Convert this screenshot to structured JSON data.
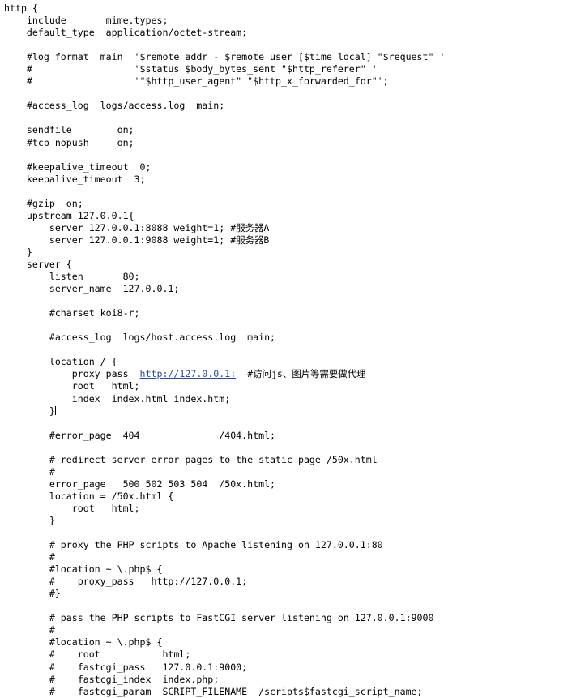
{
  "document": {
    "type": "nginx-configuration-file",
    "language": "nginx-conf",
    "background_color": "#ffffff",
    "text_color": "#000000",
    "link_color": "#2b4ba8",
    "caret_after_line_index": 33
  },
  "lines": [
    "http {",
    "    include       mime.types;",
    "    default_type  application/octet-stream;",
    "",
    "    #log_format  main  '$remote_addr - $remote_user [$time_local] \"$request\" '",
    "    #                  '$status $body_bytes_sent \"$http_referer\" '",
    "    #                  '\"$http_user_agent\" \"$http_x_forwarded_for\"';",
    "",
    "    #access_log  logs/access.log  main;",
    "",
    "    sendfile        on;",
    "    #tcp_nopush     on;",
    "",
    "    #keepalive_timeout  0;",
    "    keepalive_timeout  3;",
    "",
    "    #gzip  on;",
    "    upstream 127.0.0.1{",
    "        server 127.0.0.1:8088 weight=1; #服务器A",
    "        server 127.0.0.1:9088 weight=1; #服务器B",
    "    }",
    "    server {",
    "        listen       80;",
    "        server_name  127.0.0.1;",
    "",
    "        #charset koi8-r;",
    "",
    "        #access_log  logs/host.access.log  main;",
    "",
    "        location / {",
    "            proxy_pass  http://127.0.0.1;  #访问js、图片等需要做代理",
    "            root   html;",
    "            index  index.html index.htm;",
    "        }",
    "",
    "        #error_page  404              /404.html;",
    "",
    "        # redirect server error pages to the static page /50x.html",
    "        #",
    "        error_page   500 502 503 504  /50x.html;",
    "        location = /50x.html {",
    "            root   html;",
    "        }",
    "",
    "        # proxy the PHP scripts to Apache listening on 127.0.0.1:80",
    "        #",
    "        #location ~ \\.php$ {",
    "        #    proxy_pass   http://127.0.0.1;",
    "        #}",
    "",
    "        # pass the PHP scripts to FastCGI server listening on 127.0.0.1:9000",
    "        #",
    "        #location ~ \\.php$ {",
    "        #    root           html;",
    "        #    fastcgi_pass   127.0.0.1:9000;",
    "        #    fastcgi_index  index.php;",
    "        #    fastcgi_param  SCRIPT_FILENAME  /scripts$fastcgi_script_name;"
  ],
  "links": [
    {
      "line_index": 30,
      "text": "http://127.0.0.1;",
      "color": "#2b4ba8"
    },
    {
      "line_index": 46,
      "text": "http://127.0.0.1;",
      "color": "#2b4ba8"
    }
  ],
  "comments_cjk": [
    {
      "line_index": 18,
      "text": "#服务器A"
    },
    {
      "line_index": 19,
      "text": "#服务器B"
    },
    {
      "line_index": 30,
      "text": "#访问js、图片等需要做代理"
    }
  ]
}
